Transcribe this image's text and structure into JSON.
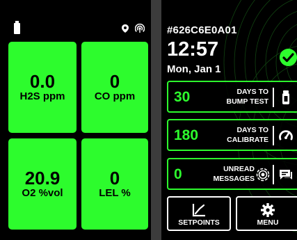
{
  "status": {
    "battery_icon": "battery-icon",
    "location_icon": "gps-pin-icon",
    "wireless_icon": "wireless-signal-icon"
  },
  "gas_tiles": [
    {
      "value": "0.0",
      "unit": "H2S ppm"
    },
    {
      "value": "0",
      "unit": "CO ppm"
    },
    {
      "value": "20.9",
      "unit": "O2 %vol"
    },
    {
      "value": "0",
      "unit": "LEL %"
    }
  ],
  "device": {
    "id": "#626C6E0A01",
    "time": "12:57",
    "date": "Mon, Jan 1"
  },
  "cards": [
    {
      "value": "30",
      "label_line1": "DAYS TO",
      "label_line2": "BUMP TEST",
      "icon": "bump-test-icon"
    },
    {
      "value": "180",
      "label_line1": "DAYS TO",
      "label_line2": "CALIBRATE",
      "icon": "gauge-icon"
    },
    {
      "value": "0",
      "label_line1": "UNREAD",
      "label_line2": "MESSAGES",
      "icon": "message-icon"
    }
  ],
  "buttons": {
    "setpoints": "SETPOINTS",
    "menu": "MENU"
  },
  "colors": {
    "accent": "#2dfc2d",
    "divider": "#3c3c3c",
    "background": "#000000"
  }
}
